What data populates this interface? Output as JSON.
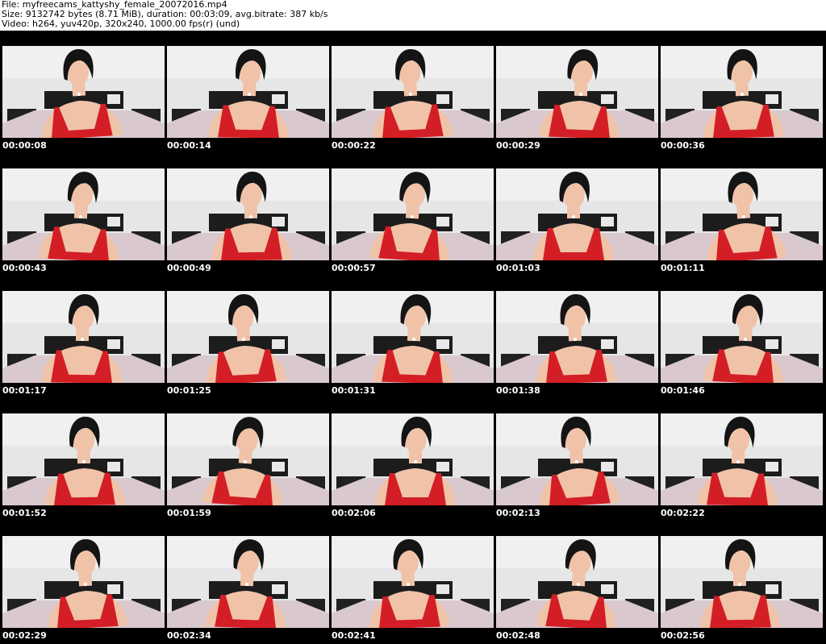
{
  "header": {
    "line1": "File: myfreecams_kattyshy_female_20072016.mp4",
    "line2": "Size: 9132742 bytes (8.71 MiB), duration: 00:03:09, avg.bitrate: 387 kb/s",
    "line3": "Video: h264, yuv420p, 320x240, 1000.00 fps(r) (und)"
  },
  "thumbnails": [
    {
      "time": "00:00:08"
    },
    {
      "time": "00:00:14"
    },
    {
      "time": "00:00:22"
    },
    {
      "time": "00:00:29"
    },
    {
      "time": "00:00:36"
    },
    {
      "time": "00:00:43"
    },
    {
      "time": "00:00:49"
    },
    {
      "time": "00:00:57"
    },
    {
      "time": "00:01:03"
    },
    {
      "time": "00:01:11"
    },
    {
      "time": "00:01:17"
    },
    {
      "time": "00:01:25"
    },
    {
      "time": "00:01:31"
    },
    {
      "time": "00:01:38"
    },
    {
      "time": "00:01:46"
    },
    {
      "time": "00:01:52"
    },
    {
      "time": "00:01:59"
    },
    {
      "time": "00:02:06"
    },
    {
      "time": "00:02:13"
    },
    {
      "time": "00:02:22"
    },
    {
      "time": "00:02:29"
    },
    {
      "time": "00:02:34"
    },
    {
      "time": "00:02:41"
    },
    {
      "time": "00:02:48"
    },
    {
      "time": "00:02:56"
    }
  ],
  "colors": {
    "sheet_background": "#000000",
    "header_background": "#ffffff",
    "timestamp_text": "#ffffff",
    "wall": "#e6e6e6",
    "bed": "#d9c9cf",
    "top_red": "#d41e26",
    "hair": "#141414",
    "skin": "#f0c3a8"
  }
}
